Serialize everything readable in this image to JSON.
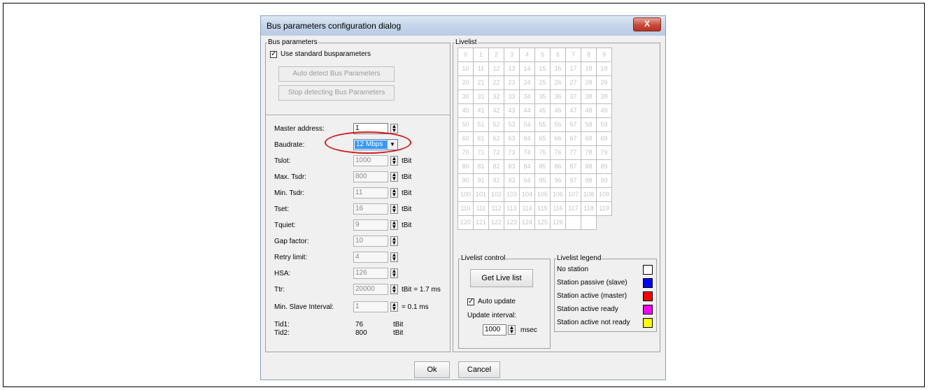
{
  "dialog": {
    "title": "Bus parameters configuration dialog",
    "close_label": "X"
  },
  "bus_parameters": {
    "group_title": "Bus parameters",
    "use_standard_label": "Use standard busparameters",
    "use_standard_checked": true,
    "auto_detect_label": "Auto detect Bus Parameters",
    "stop_detect_label": "Stop detecting Bus Parameters",
    "fields": [
      {
        "label": "Master address:",
        "value": "1",
        "unit": ""
      },
      {
        "label": "Baudrate:",
        "value": "12 Mbps",
        "unit": ""
      },
      {
        "label": "Tslot:",
        "value": "1000",
        "unit": "tBit"
      },
      {
        "label": "Max. Tsdr:",
        "value": "800",
        "unit": "tBit"
      },
      {
        "label": "Min. Tsdr:",
        "value": "11",
        "unit": "tBit"
      },
      {
        "label": "Tset:",
        "value": "16",
        "unit": "tBit"
      },
      {
        "label": "Tquiet:",
        "value": "9",
        "unit": "tBit"
      },
      {
        "label": "Gap factor:",
        "value": "10",
        "unit": ""
      },
      {
        "label": "Retry limit:",
        "value": "4",
        "unit": ""
      },
      {
        "label": "HSA:",
        "value": "126",
        "unit": ""
      },
      {
        "label": "Ttr:",
        "value": "20000",
        "unit": "tBit = 1.7 ms"
      },
      {
        "label": "Min. Slave Interval:",
        "value": "1",
        "unit": "= 0.1 ms"
      }
    ],
    "tid1_label": "Tid1:",
    "tid1_value": "76",
    "tid1_unit": "tBit",
    "tid2_label": "Tid2:",
    "tid2_value": "800",
    "tid2_unit": "tBit"
  },
  "livelist": {
    "group_title": "Livelist",
    "cells": [
      "0",
      "1",
      "2",
      "3",
      "4",
      "5",
      "6",
      "7",
      "8",
      "9",
      "10",
      "11",
      "12",
      "13",
      "14",
      "15",
      "16",
      "17",
      "18",
      "19",
      "20",
      "21",
      "22",
      "23",
      "24",
      "25",
      "26",
      "27",
      "28",
      "29",
      "30",
      "31",
      "32",
      "33",
      "34",
      "35",
      "36",
      "37",
      "38",
      "39",
      "40",
      "41",
      "42",
      "43",
      "44",
      "45",
      "46",
      "47",
      "48",
      "49",
      "50",
      "51",
      "52",
      "53",
      "54",
      "55",
      "56",
      "57",
      "58",
      "59",
      "60",
      "61",
      "62",
      "63",
      "64",
      "65",
      "66",
      "67",
      "68",
      "69",
      "70",
      "71",
      "72",
      "73",
      "74",
      "75",
      "76",
      "77",
      "78",
      "79",
      "80",
      "81",
      "82",
      "83",
      "84",
      "85",
      "86",
      "87",
      "88",
      "89",
      "90",
      "91",
      "92",
      "93",
      "94",
      "95",
      "96",
      "97",
      "98",
      "99",
      "100",
      "101",
      "102",
      "103",
      "104",
      "105",
      "106",
      "107",
      "108",
      "109",
      "110",
      "111",
      "112",
      "113",
      "114",
      "115",
      "116",
      "117",
      "118",
      "119",
      "120",
      "121",
      "122",
      "123",
      "124",
      "125",
      "126",
      "",
      ""
    ]
  },
  "livelist_control": {
    "group_title": "Livelist control",
    "get_live_list_label": "Get Live list",
    "auto_update_label": "Auto update",
    "auto_update_checked": true,
    "update_interval_label": "Update interval:",
    "update_interval_value": "1000",
    "update_interval_unit": "msec"
  },
  "livelist_legend": {
    "group_title": "Livelist legend",
    "items": [
      {
        "label": "No station",
        "color": "#ffffff"
      },
      {
        "label": "Station passive (slave)",
        "color": "#0000ff"
      },
      {
        "label": "Station active (master)",
        "color": "#ff0000"
      },
      {
        "label": "Station active ready",
        "color": "#ff00ff"
      },
      {
        "label": "Station active not ready",
        "color": "#ffff00"
      }
    ]
  },
  "buttons": {
    "ok_label": "Ok",
    "cancel_label": "Cancel"
  }
}
